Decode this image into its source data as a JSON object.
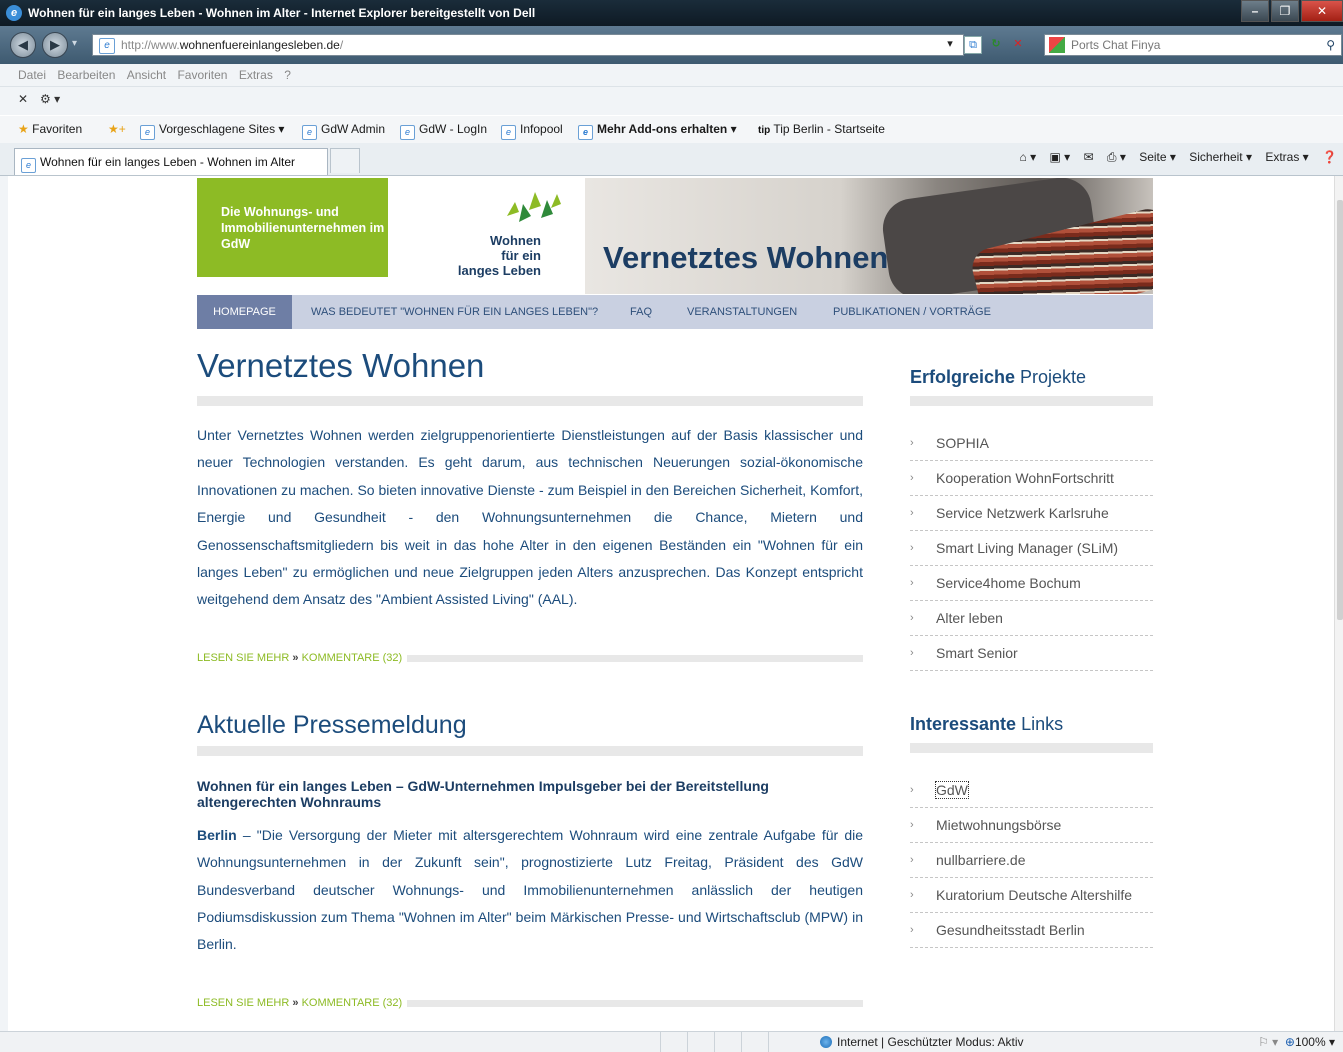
{
  "window": {
    "title": "Wohnen für ein langes Leben - Wohnen im Alter - Internet Explorer bereitgestellt von Dell"
  },
  "address": {
    "url_prefix": "http://www.",
    "url_domain": "wohnenfuereinlangesleben.de",
    "url_suffix": "/",
    "search_placeholder": "Ports Chat Finya"
  },
  "menu": [
    "Datei",
    "Bearbeiten",
    "Ansicht",
    "Favoriten",
    "Extras",
    "?"
  ],
  "favorites_bar": {
    "favoriten": "Favoriten",
    "suggested": "Vorgeschlagene Sites ▾",
    "links": [
      "GdW Admin",
      "GdW - LogIn",
      "Infopool"
    ],
    "addons": "Mehr Add-ons erhalten ▾",
    "tipberlin": "Tip Berlin - Startseite"
  },
  "tab": {
    "label": "Wohnen für ein langes Leben - Wohnen im Alter"
  },
  "command_bar": {
    "seite": "Seite ▾",
    "sicherheit": "Sicherheit ▾",
    "extras": "Extras ▾"
  },
  "status": {
    "zone": "Internet | Geschützter Modus: Aktiv",
    "zoom": "100%"
  },
  "site": {
    "green_text": "Die Wohnungs- und Immobilienunternehmen im GdW",
    "logo_line1": "Wohnen",
    "logo_line2": "für ein",
    "logo_line3": "langes Leben",
    "hero_title": "Vernetztes Wohnen",
    "nav": [
      "HOMEPAGE",
      "WAS BEDEUTET \"WOHNEN FÜR EIN LANGES LEBEN\"?",
      "FAQ",
      "VERANSTALTUNGEN",
      "PUBLIKATIONEN / VORTRÄGE"
    ],
    "article1": {
      "title": "Vernetztes Wohnen",
      "text": "Unter Vernetztes Wohnen werden zielgruppenorientierte Dienstleistungen auf der Basis klassischer und neuer Technologien verstanden. Es geht darum, aus technischen Neuerungen sozial-ökonomische Innovationen zu machen. So bieten innovative Dienste - zum Beispiel in den Bereichen Sicherheit, Komfort, Energie und Gesundheit - den Wohnungsunternehmen die Chance, Mietern und Genossenschaftsmitgliedern bis weit in das hohe Alter in den eigenen Beständen ein \"Wohnen für ein langes Leben\" zu ermöglichen und neue Zielgruppen jeden Alters anzusprechen. Das Konzept entspricht weitgehend dem Ansatz des \"Ambient Assisted Living\" (AAL).",
      "more": "LESEN SIE MEHR",
      "sep": "»",
      "comments": "KOMMENTARE (32)"
    },
    "article2": {
      "section_title": "Aktuelle Pressemeldung",
      "headline": "Wohnen für ein langes Leben – GdW-Unternehmen Impulsgeber bei der Bereitstellung altengerechten Wohnraums",
      "lead": "Berlin",
      "text": " – \"Die Versorgung der Mieter mit altersgerechtem Wohnraum wird eine zentrale Aufgabe für die Wohnungsunternehmen in der Zukunft sein\", prognostizierte Lutz Freitag, Präsident des GdW Bundesverband deutscher Wohnungs- und Immobilienunternehmen anlässlich der heutigen Podiumsdiskussion zum Thema \"Wohnen im Alter\" beim Märkischen Presse- und Wirtschaftsclub (MPW) in Berlin.",
      "more": "LESEN SIE MEHR",
      "sep": "»",
      "comments": "KOMMENTARE (32)"
    },
    "sidebar1": {
      "title_bold": "Erfolgreiche",
      "title_rest": " Projekte",
      "items": [
        "SOPHIA",
        "Kooperation WohnFortschritt",
        "Service Netzwerk Karlsruhe",
        "Smart Living Manager (SLiM)",
        "Service4home Bochum",
        "Alter leben",
        "Smart Senior"
      ]
    },
    "sidebar2": {
      "title_bold": "Interessante",
      "title_rest": " Links",
      "items": [
        "GdW",
        "Mietwohnungsbörse",
        "nullbarriere.de",
        "Kuratorium Deutsche Altershilfe",
        "Gesundheitsstadt Berlin"
      ]
    }
  },
  "colors": {
    "brand_green": "#8dbb25",
    "brand_blue": "#1c4c7c",
    "nav_bg": "#c9d0e1",
    "nav_active": "#6e7ea5"
  }
}
